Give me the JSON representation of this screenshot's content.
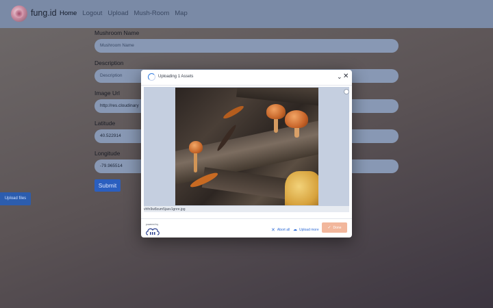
{
  "navbar": {
    "brand": "fung.id",
    "links": [
      "Home",
      "Logout",
      "Upload",
      "Mush-Room",
      "Map"
    ],
    "active": "Home"
  },
  "form": {
    "name_label": "Mushroom Name",
    "name_placeholder": "Mushroom Name",
    "description_label": "Description",
    "description_placeholder": "Description",
    "image_url_label": "Image Url",
    "image_url_value": "http://res.cloudinary",
    "latitude_label": "Latitude",
    "latitude_value": "40.522914",
    "longitude_label": "Longitude",
    "longitude_value": "-79.965514",
    "submit_label": "Submit"
  },
  "sidebar_button": {
    "label": "Upload files"
  },
  "upload_widget": {
    "title": "Uploading 1 Assets",
    "filename": "vhfn9w8zum5jasv1gnre.jpg",
    "powered_by": "powered by",
    "abort_label": "Abort all",
    "upload_more_label": "Upload more",
    "done_label": "Done",
    "accent_color": "#2e6bd6"
  }
}
